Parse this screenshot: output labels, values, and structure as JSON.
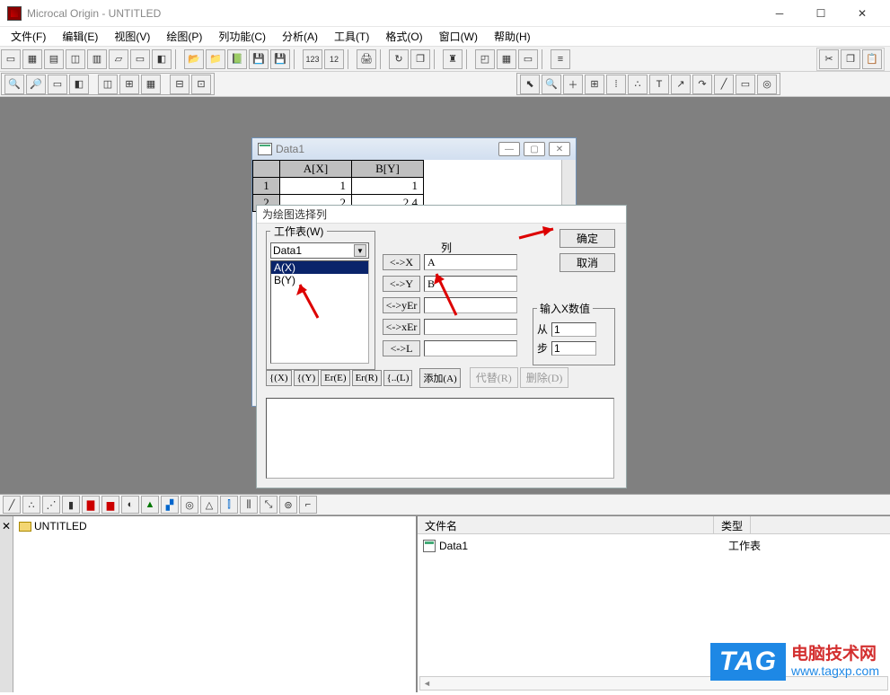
{
  "title": "Microcal Origin - UNTITLED",
  "menus": [
    "文件(F)",
    "编辑(E)",
    "视图(V)",
    "绘图(P)",
    "列功能(C)",
    "分析(A)",
    "工具(T)",
    "格式(O)",
    "窗口(W)",
    "帮助(H)"
  ],
  "data_window": {
    "title": "Data1",
    "columns": [
      "A[X]",
      "B[Y]"
    ],
    "rows": [
      {
        "n": "1",
        "a": "1",
        "b": "1"
      },
      {
        "n": "2",
        "a": "2",
        "b": "2.4"
      }
    ]
  },
  "dialog": {
    "title": "为绘图选择列",
    "worksheet_label": "工作表(W)",
    "worksheet_selected": "Data1",
    "list": [
      "A(X)",
      "B(Y)"
    ],
    "col_heading": "列",
    "assign_btns": [
      "<->X",
      "<->Y",
      "<->yEr",
      "<->xEr",
      "<->L"
    ],
    "field_x": "A",
    "field_y": "B",
    "field_yer": "",
    "field_xer": "",
    "field_l": "",
    "ok": "确定",
    "cancel": "取消",
    "xvals_label": "输入X数值",
    "from_label": "从",
    "from_val": "1",
    "step_label": "步",
    "step_val": "1",
    "row_btns": [
      "{(X)",
      "{(Y)",
      "Er(E)",
      "Er(R)",
      "{..(L)",
      "添加(A)"
    ],
    "replace_btn": "代替(R)",
    "delete_btn": "删除(D)"
  },
  "project_tree": {
    "root": "UNTITLED"
  },
  "list_pane": {
    "col1": "文件名",
    "col2": "类型",
    "item_name": "Data1",
    "item_type": "工作表"
  },
  "watermark": {
    "tag": "TAG",
    "line1": "电脑技术网",
    "line2": "www.tagxp.com"
  }
}
